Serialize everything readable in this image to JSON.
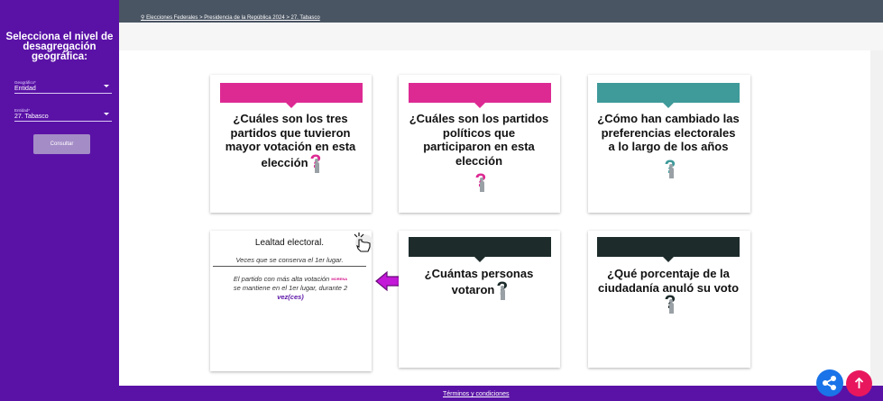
{
  "sidebar": {
    "title": "Selecciona el nivel de desagregación geográfica:",
    "geografico_label": "Geográfico*",
    "geografico_value": "Entidad",
    "entidad_label": "Entidad*",
    "entidad_value": "27. Tabasco",
    "consultar": "Consultar"
  },
  "breadcrumb": "Elecciones Federales > Presidencia de la República 2024 > 27. Tabasco",
  "cards": [
    {
      "question": "¿Cuáles son los tres partidos que tuvieron mayor votación en esta elección",
      "band_color": "#dd2a93",
      "icon_color": "#dd2a93"
    },
    {
      "question": "¿Cuáles son los partidos políticos que participaron en esta elección",
      "band_color": "#dd2a93",
      "icon_color": "#dd2a93"
    },
    {
      "question": "¿Cómo han cambiado las preferencias electorales a lo largo de los años",
      "band_color": "#3f9a9a",
      "icon_color": "#3f9a9a"
    },
    {
      "question": "¿Cuántas personas votaron",
      "band_color": "#1d2b2b",
      "icon_color": "#1d2b2b"
    },
    {
      "question": "¿Qué porcentaje de la ciudadanía anuló su voto",
      "band_color": "#1d2b2b",
      "icon_color": "#1d2b2b"
    }
  ],
  "lealtad": {
    "title": "Lealtad electoral.",
    "subtitle": "Veces que se conserva el 1er lugar.",
    "body_prefix": "El partido con más alta votación",
    "party_tag": "MORENA",
    "body_suffix": "se mantiene en el 1er lugar, durante 2",
    "body_vez": "vez(ces)"
  },
  "footer": {
    "terms": "Términos y condiciones"
  },
  "colors": {
    "sidebar": "#5a12a6",
    "share": "#1a73e8",
    "totop": "#e8175d"
  }
}
